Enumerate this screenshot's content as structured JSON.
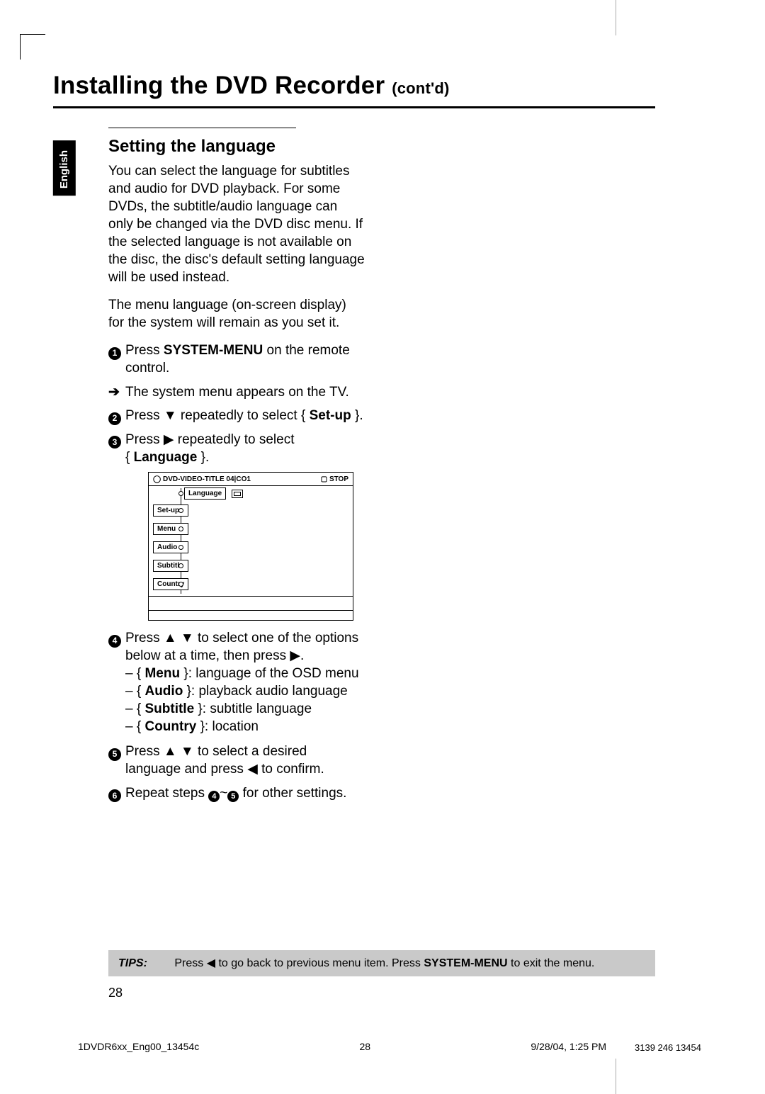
{
  "lang_tab": "English",
  "title_main": "Installing the DVD Recorder",
  "title_cont": "(cont'd)",
  "section_heading": "Setting the language",
  "intro1": "You can select the language for subtitles and audio for DVD playback.  For some DVDs, the subtitle/audio language can only be changed via the DVD disc menu.  If the selected language is not available on the disc, the disc's default setting language will be used instead.",
  "intro2": "The menu language (on-screen display) for the system will remain as you set it.",
  "step1_a": "Press ",
  "step1_b": "SYSTEM-MENU",
  "step1_c": " on the remote control.",
  "step1_res": "The system menu appears on the TV.",
  "step2_a": "Press ▼ repeatedly to select { ",
  "step2_b": "Set-up",
  "step2_c": " }.",
  "step3_a": "Press ▶ repeatedly to select",
  "step3_b": "Language",
  "step3_brace_l": "{ ",
  "step3_brace_r": " }.",
  "osd": {
    "header_left": "DVD-VIDEO-TITLE 04|CO1",
    "header_right": "STOP",
    "top_cell": "Language",
    "rows": [
      "Set-up",
      "Menu",
      "Audio",
      "Subtitle",
      "Country"
    ]
  },
  "step4_a": "Press ▲ ▼ to select one of the options below at a time, then press ▶.",
  "step4_items": [
    {
      "k": "Menu",
      "d": " }: language of the OSD menu"
    },
    {
      "k": "Audio",
      "d": " }: playback audio language"
    },
    {
      "k": "Subtitle",
      "d": " }: subtitle language"
    },
    {
      "k": "Country",
      "d": " }: location"
    }
  ],
  "step5": "Press ▲ ▼ to select a desired language and press ◀ to confirm.",
  "step6_a": "Repeat steps ",
  "step6_b": "~",
  "step6_c": " for other settings.",
  "tips_label": "TIPS:",
  "tips_a": "Press ◀ to go back to previous menu item.  Press ",
  "tips_b": "SYSTEM-MENU",
  "tips_c": " to exit the menu.",
  "page_no": "28",
  "footer_file": "1DVDR6xx_Eng00_13454c",
  "footer_pg": "28",
  "footer_date": "9/28/04, 1:25 PM",
  "footer_code": "3139 246 13454"
}
